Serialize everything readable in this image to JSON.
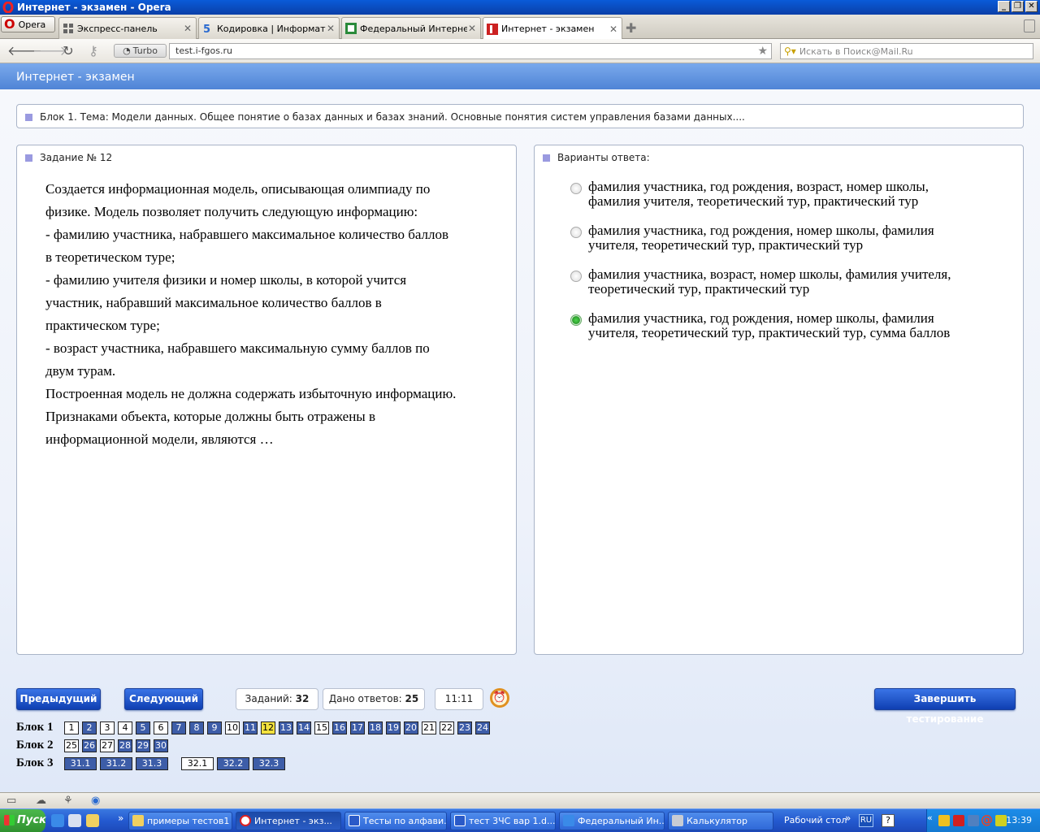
{
  "window": {
    "title": "Интернет - экзамен - Opera"
  },
  "browser": {
    "menu_label": "Opera",
    "tabs": [
      {
        "label": "Экспресс-панель",
        "icon": "grid-icon"
      },
      {
        "label": "Кодировка | Информат...",
        "icon": "site-icon"
      },
      {
        "label": "Федеральный Интерне...",
        "icon": "site-icon"
      },
      {
        "label": "Интернет - экзамен",
        "icon": "site-icon"
      }
    ],
    "turbo_label": "Turbo",
    "url": "test.i-fgos.ru",
    "search_placeholder": "Искать в Поиск@Mail.Ru"
  },
  "app": {
    "header": "Интернет - экзамен",
    "block_topic": "Блок 1. Тема: Модели данных. Общее понятие о базах данных и базах знаний. Основные понятия систем управления базами данных....",
    "task_title": "Задание № 12",
    "question_lines": [
      "Создается  информационная модель, описывающая олимпиаду по",
      "физике. Модель позволяет получить следующую информацию:",
      " - фамилию участника, набравшего максимальное количество баллов",
      "в теоретическом туре;",
      " - фамилию учителя физики и номер школы, в которой учится",
      "участник, набравший максимальное количество баллов в",
      "практическом туре;",
      " - возраст участника, набравшего максимальную сумму баллов по",
      "двум турам.",
      "Построенная модель не должна содержать избыточную информацию.",
      "Признаками объекта, которые должны быть отражены в",
      "информационной модели, являются …"
    ],
    "answers_title": "Варианты ответа:",
    "answers": [
      {
        "lines": [
          "фамилия участника, год рождения, возраст, номер школы,",
          "фамилия учителя, теоретический тур, практический тур"
        ],
        "selected": false
      },
      {
        "lines": [
          "фамилия участника, год рождения, номер школы, фамилия",
          "учителя, теоретический тур, практический тур"
        ],
        "selected": false
      },
      {
        "lines": [
          "фамилия участника, возраст, номер школы, фамилия учителя,",
          "теоретический тур, практический тур"
        ],
        "selected": false
      },
      {
        "lines": [
          "фамилия участника, год рождения, номер школы, фамилия",
          "учителя, теоретический тур, практический тур, сумма баллов"
        ],
        "selected": true
      }
    ],
    "prev_label": "Предыдущий",
    "next_label": "Следующий",
    "tasks_label": "Заданий:",
    "tasks_count": "32",
    "answered_label": "Дано ответов:",
    "answered_count": "25",
    "timer": "11:11",
    "finish_label": "Завершить тестирование",
    "blocks": [
      {
        "label": "Блок 1",
        "items": [
          {
            "n": "1",
            "state": "unanswered"
          },
          {
            "n": "2",
            "state": "answered"
          },
          {
            "n": "3",
            "state": "unanswered"
          },
          {
            "n": "4",
            "state": "unanswered"
          },
          {
            "n": "5",
            "state": "answered"
          },
          {
            "n": "6",
            "state": "unanswered"
          },
          {
            "n": "7",
            "state": "answered"
          },
          {
            "n": "8",
            "state": "answered"
          },
          {
            "n": "9",
            "state": "answered"
          },
          {
            "n": "10",
            "state": "unanswered"
          },
          {
            "n": "11",
            "state": "answered"
          },
          {
            "n": "12",
            "state": "current"
          },
          {
            "n": "13",
            "state": "answered"
          },
          {
            "n": "14",
            "state": "answered"
          },
          {
            "n": "15",
            "state": "unanswered"
          },
          {
            "n": "16",
            "state": "answered"
          },
          {
            "n": "17",
            "state": "answered"
          },
          {
            "n": "18",
            "state": "answered"
          },
          {
            "n": "19",
            "state": "answered"
          },
          {
            "n": "20",
            "state": "answered"
          },
          {
            "n": "21",
            "state": "unanswered"
          },
          {
            "n": "22",
            "state": "unanswered"
          },
          {
            "n": "23",
            "state": "answered"
          },
          {
            "n": "24",
            "state": "answered"
          }
        ]
      },
      {
        "label": "Блок 2",
        "items": [
          {
            "n": "25",
            "state": "unanswered"
          },
          {
            "n": "26",
            "state": "answered"
          },
          {
            "n": "27",
            "state": "unanswered"
          },
          {
            "n": "28",
            "state": "answered"
          },
          {
            "n": "29",
            "state": "answered"
          },
          {
            "n": "30",
            "state": "answered"
          }
        ]
      },
      {
        "label": "Блок 3",
        "items": [
          {
            "n": "31.1",
            "state": "answered"
          },
          {
            "n": "31.2",
            "state": "answered"
          },
          {
            "n": "31.3",
            "state": "answered"
          },
          {
            "n": "32.1",
            "state": "unanswered"
          },
          {
            "n": "32.2",
            "state": "answered"
          },
          {
            "n": "32.3",
            "state": "answered"
          }
        ]
      }
    ]
  },
  "taskbar": {
    "start_label": "Пуск",
    "items": [
      {
        "label": "примеры тестов1",
        "icon": "folder-icon",
        "active": false
      },
      {
        "label": "Интернет - экз...",
        "icon": "opera-icon",
        "active": true
      },
      {
        "label": "Тесты по алфави...",
        "icon": "word-icon",
        "active": false
      },
      {
        "label": "тест 3ЧС вар 1.d...",
        "icon": "word-icon",
        "active": false
      },
      {
        "label": "Федеральный Ин...",
        "icon": "ie-icon",
        "active": false
      },
      {
        "label": "Калькулятор",
        "icon": "calculator-icon",
        "active": false
      }
    ],
    "desktop_label": "Рабочий стол",
    "lang": "RU",
    "time": "13:39"
  },
  "colors": {
    "accent": "#2a5cd0",
    "answered": "#3d5da8",
    "current": "#f3e13d",
    "selected_radio": "#2c9c2c"
  }
}
